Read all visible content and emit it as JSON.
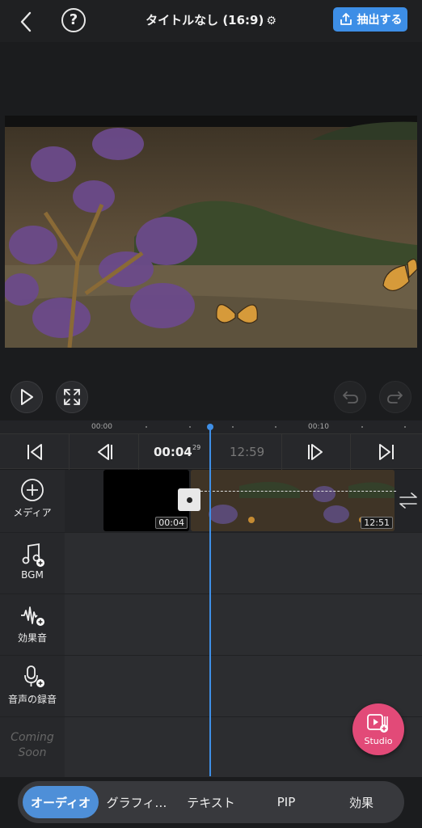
{
  "header": {
    "back_icon": "chevron-left-icon",
    "help_label": "?",
    "title": "タイトルなし (16:9)",
    "settings_icon": "gear-icon",
    "export_label": "抽出する",
    "export_icon": "share-icon",
    "accent_color": "#3d8ee6"
  },
  "ruler": {
    "ticks": [
      "00:00",
      "00:10"
    ]
  },
  "transport": {
    "current_time": "00:04",
    "current_frame": "29",
    "total_time": "12:59"
  },
  "tracks": {
    "media": {
      "label": "メディア",
      "icon": "add-circle-icon"
    },
    "bgm": {
      "label": "BGM",
      "icon": "music-note-icon"
    },
    "sfx": {
      "label": "効果音",
      "icon": "waveform-icon"
    },
    "voice": {
      "label": "音声の録音",
      "icon": "microphone-icon"
    },
    "coming_soon": {
      "label": "Coming Soon"
    }
  },
  "clips": {
    "clip1_duration": "00:04",
    "clip2_duration": "12:51"
  },
  "studio": {
    "label": "Studio",
    "color": "#e24a78"
  },
  "tabs": [
    {
      "label": "オーディオ",
      "active": true
    },
    {
      "label": "グラフィ…",
      "active": false
    },
    {
      "label": "テキスト",
      "active": false
    },
    {
      "label": "PIP",
      "active": false
    },
    {
      "label": "効果",
      "active": false
    }
  ]
}
